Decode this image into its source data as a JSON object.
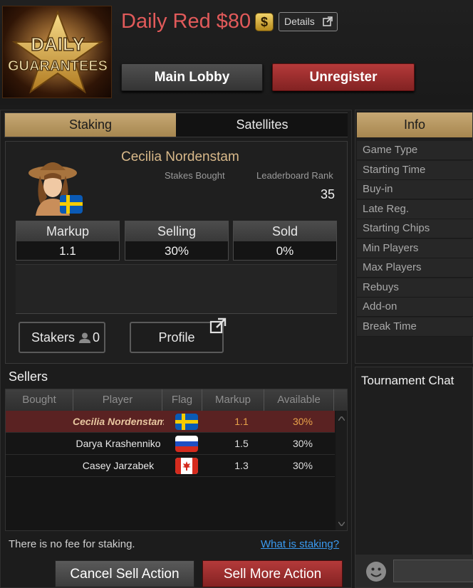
{
  "header": {
    "logo_text": [
      "DAILY",
      "GUARANTEES"
    ],
    "title": "Daily Red $80",
    "dollar_badge": "$",
    "details_label": "Details",
    "main_lobby_label": "Main Lobby",
    "unregister_label": "Unregister"
  },
  "tabs": [
    {
      "label": "Staking",
      "active": true
    },
    {
      "label": "Satellites",
      "active": false
    }
  ],
  "staker": {
    "name": "Cecilia Nordenstam",
    "flag": "sweden-flag",
    "stakes_bought_label": "Stakes Bought",
    "leaderboard_rank_label": "Leaderboard Rank",
    "leaderboard_rank": "35",
    "stats": [
      {
        "label": "Markup",
        "value": "1.1"
      },
      {
        "label": "Selling",
        "value": "30%"
      },
      {
        "label": "Sold",
        "value": "0%"
      }
    ],
    "stakers_label": "Stakers",
    "stakers_count": "0",
    "profile_label": "Profile"
  },
  "sellers": {
    "title": "Sellers",
    "columns": [
      "Bought",
      "Player",
      "Flag",
      "Markup",
      "Available"
    ],
    "rows": [
      {
        "player": "Cecilia Nordenstam",
        "flag": "sweden-flag",
        "markup": "1.1",
        "available": "30%",
        "selected": true
      },
      {
        "player": "Darya Krashenniko",
        "flag": "russia-flag",
        "markup": "1.5",
        "available": "30%",
        "selected": false
      },
      {
        "player": "Casey Jarzabek",
        "flag": "canada-flag",
        "markup": "1.3",
        "available": "30%",
        "selected": false
      }
    ]
  },
  "footer": {
    "no_fee_text": "There is no fee for staking.",
    "what_is_staking": "What is staking?",
    "cancel_sell_label": "Cancel Sell Action",
    "sell_more_label": "Sell More Action"
  },
  "info": {
    "tab_label": "Info",
    "rows": [
      "Game Type",
      "Starting Time",
      "Buy-in",
      "Late Reg.",
      "Starting Chips",
      "Min Players",
      "Max Players",
      "Rebuys",
      "Add-on",
      "Break Time"
    ]
  },
  "chat": {
    "title": "Tournament Chat",
    "input_value": ""
  },
  "colors": {
    "title_red": "#e15a5a",
    "gold_tab": "#b8955f",
    "accent_orange": "#e8a24a",
    "selected_row": "#5a2222",
    "link_blue": "#3a9af0"
  }
}
